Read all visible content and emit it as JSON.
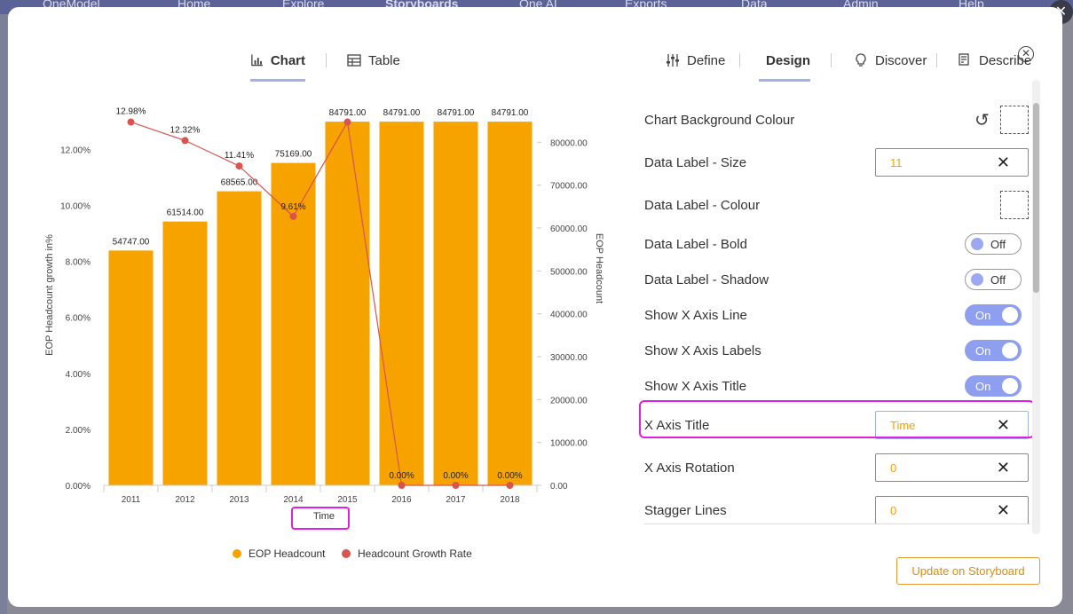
{
  "background": {
    "nav_items": [
      "OneModel",
      "Home",
      "Explore",
      "Storyboards",
      "One AI",
      "Exports",
      "Data",
      "Admin",
      "Help"
    ]
  },
  "tabs": {
    "left": [
      {
        "label": "Chart",
        "icon": "bar-chart-icon",
        "active": true
      },
      {
        "label": "Table",
        "icon": "table-icon",
        "active": false
      }
    ],
    "right": [
      {
        "label": "Define",
        "icon": "sliders-icon",
        "active": false
      },
      {
        "label": "Design",
        "icon": "palette-icon",
        "active": true
      },
      {
        "label": "Discover",
        "icon": "lightbulb-icon",
        "active": false
      },
      {
        "label": "Describe",
        "icon": "describe-icon",
        "active": false
      }
    ]
  },
  "chart_data": {
    "type": "bar",
    "categories": [
      "2011",
      "2012",
      "2013",
      "2014",
      "2015",
      "2016",
      "2017",
      "2018"
    ],
    "series": [
      {
        "name": "EOP Headcount",
        "type": "bar",
        "axis": "right",
        "color": "#f6a300",
        "values": [
          54747.0,
          61514.0,
          68565.0,
          75169.0,
          84791.0,
          84791.0,
          84791.0,
          84791.0
        ],
        "labels": [
          "54747.00",
          "61514.00",
          "68565.00",
          "75169.00",
          "84791.00",
          "84791.00",
          "84791.00",
          "84791.00"
        ]
      },
      {
        "name": "Headcount Growth Rate",
        "type": "line",
        "axis": "left",
        "color": "#d9534f",
        "values": [
          12.98,
          12.32,
          11.41,
          9.61,
          12.98,
          0.0,
          0.0,
          0.0
        ],
        "labels": [
          "12.98%",
          "12.32%",
          "11.41%",
          "9.61%",
          "",
          "0.00%",
          "0.00%",
          "0.00%"
        ]
      }
    ],
    "xlabel": "Time",
    "ylabel_left": "EOP Headcount growth in%",
    "ylabel_right": "EOP Headcount",
    "yticks_left": [
      "0.00%",
      "2.00%",
      "4.00%",
      "6.00%",
      "8.00%",
      "10.00%",
      "12.00%"
    ],
    "ylim_left": [
      0,
      13.6
    ],
    "yticks_right": [
      "0.00",
      "10000.00",
      "20000.00",
      "30000.00",
      "40000.00",
      "50000.00",
      "60000.00",
      "70000.00",
      "80000.00"
    ],
    "ylim_right": [
      0,
      88750
    ],
    "legend_position": "bottom"
  },
  "design": {
    "rows": [
      {
        "label": "Chart Background Colour",
        "kind": "colour-reset"
      },
      {
        "label": "Data Label - Size",
        "kind": "text",
        "value": "11"
      },
      {
        "label": "Data Label - Colour",
        "kind": "colour"
      },
      {
        "label": "Data Label - Bold",
        "kind": "toggle",
        "state": "Off"
      },
      {
        "label": "Data Label - Shadow",
        "kind": "toggle",
        "state": "Off"
      },
      {
        "label": "Show X Axis Line",
        "kind": "toggle",
        "state": "On"
      },
      {
        "label": "Show X Axis Labels",
        "kind": "toggle",
        "state": "On"
      },
      {
        "label": "Show X Axis Title",
        "kind": "toggle",
        "state": "On"
      },
      {
        "label": "X Axis Title",
        "kind": "text",
        "value": "Time"
      },
      {
        "label": "X Axis Rotation",
        "kind": "text",
        "value": "0"
      },
      {
        "label": "Stagger Lines",
        "kind": "text",
        "value": "0"
      }
    ]
  },
  "update_button_label": "Update on Storyboard",
  "colors": {
    "accent": "#8f9ff0",
    "bar": "#f6a300",
    "line": "#d9534f",
    "highlight": "#e020e0",
    "value_text": "#f4a000"
  }
}
